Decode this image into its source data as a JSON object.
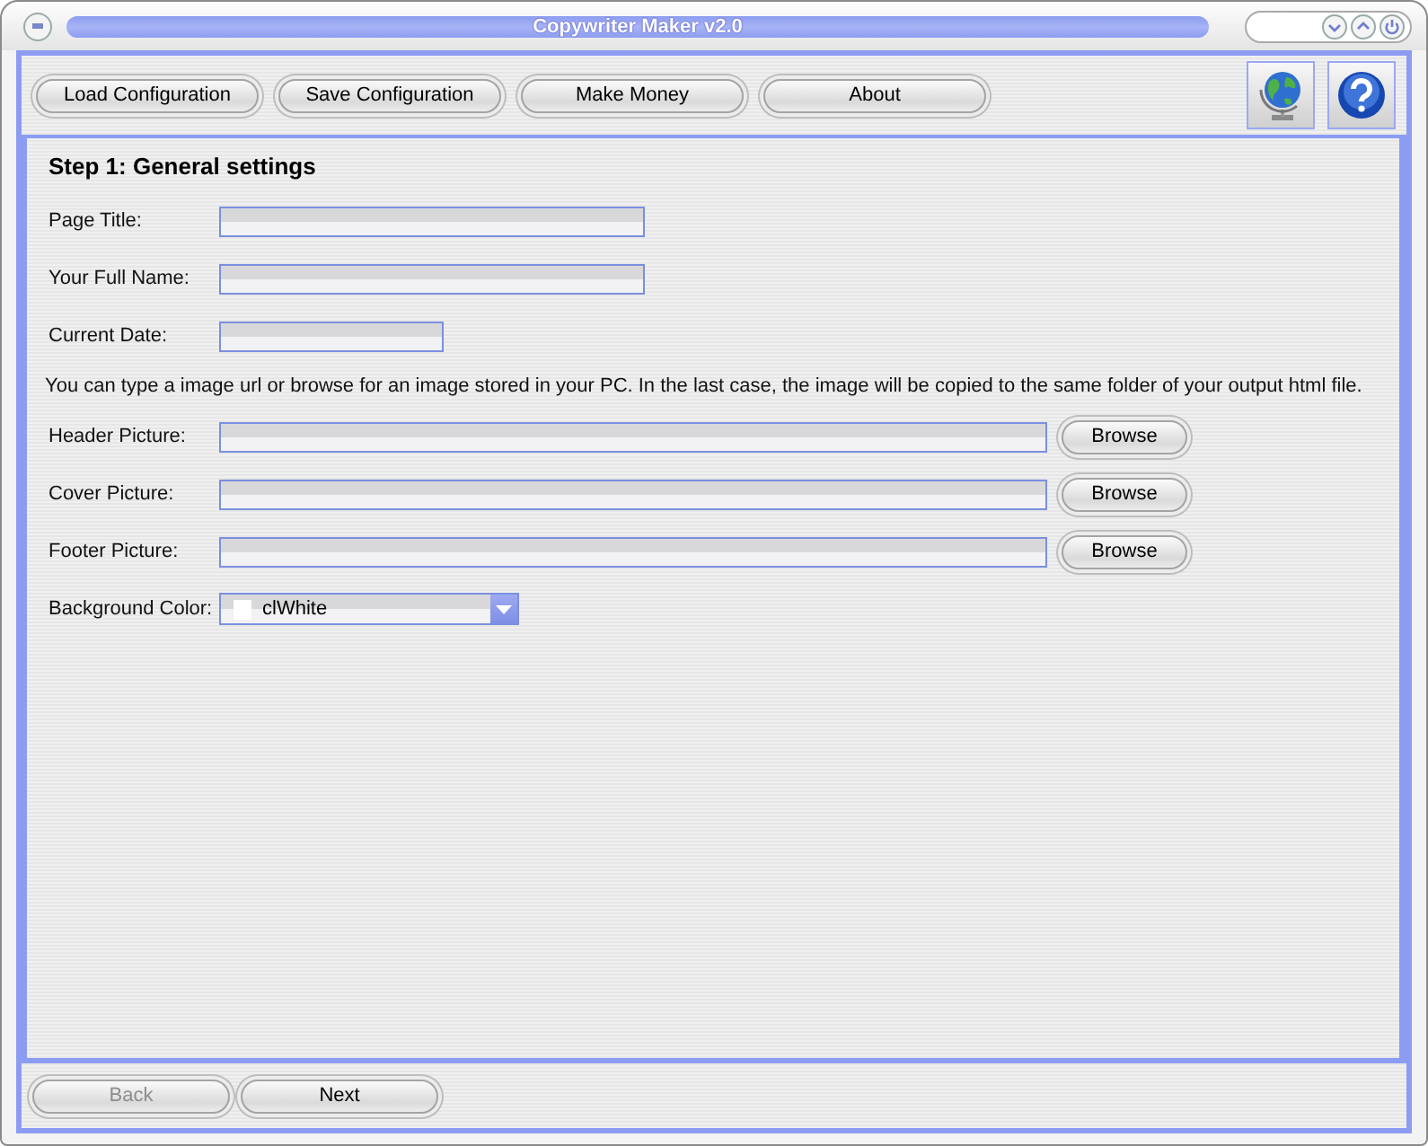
{
  "window": {
    "title": "Copywriter Maker v2.0"
  },
  "toolbar": {
    "buttons": [
      "Load Configuration",
      "Save Configuration",
      "Make Money",
      "About"
    ]
  },
  "step_title": "Step 1: General settings",
  "fields": [
    {
      "kind": "text",
      "label": "Page Title:"
    },
    {
      "kind": "text",
      "label": "Your Full Name:"
    },
    {
      "kind": "date",
      "label": "Current Date:"
    },
    {
      "kind": "note",
      "text": "You can type a image url or browse for an image stored in your PC. In the last case, the image will be copied to the same folder of your output html file."
    },
    {
      "kind": "file",
      "label": "Header Picture:",
      "button": "Browse"
    },
    {
      "kind": "file",
      "label": "Cover Picture:",
      "button": "Browse"
    },
    {
      "kind": "file",
      "label": "Footer Picture:",
      "button": "Browse"
    },
    {
      "kind": "color",
      "label": "Background Color:",
      "value": "clWhite",
      "color": "#ffffff"
    }
  ],
  "nav": [
    {
      "label": "Back",
      "disabled": true
    },
    {
      "label": "Next",
      "disabled": false
    }
  ]
}
